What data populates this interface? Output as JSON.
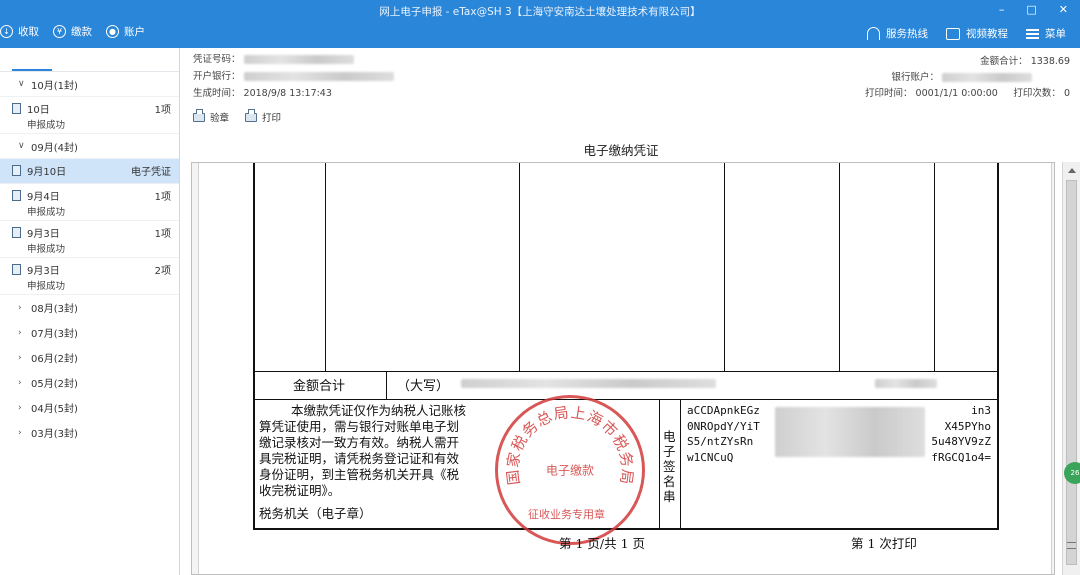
{
  "window": {
    "title": "网上电子申报 - eTax@SH 3【上海守安南达土壤处理技术有限公司】",
    "controls": [
      "–",
      "□",
      "✕"
    ]
  },
  "nav": {
    "left": [
      {
        "label": "收取",
        "icon": "download-icon"
      },
      {
        "label": "缴款",
        "icon": "yen-icon"
      },
      {
        "label": "账户",
        "icon": "user-icon"
      }
    ],
    "right": [
      {
        "label": "服务热线",
        "icon": "headset-icon"
      },
      {
        "label": "视频教程",
        "icon": "video-icon"
      },
      {
        "label": "菜单",
        "icon": "menu-icon"
      }
    ]
  },
  "sidebar": {
    "months": [
      {
        "label": "10月(1封)",
        "expanded": true,
        "records": [
          {
            "date": "10日",
            "count": "1项",
            "status": "申报成功",
            "active": false
          }
        ]
      },
      {
        "label": "09月(4封)",
        "expanded": true,
        "records": [
          {
            "date": "9月10日",
            "count": "电子凭证",
            "status": "",
            "active": true
          },
          {
            "date": "9月4日",
            "count": "1项",
            "status": "申报成功",
            "active": false
          },
          {
            "date": "9月3日",
            "count": "1项",
            "status": "申报成功",
            "active": false
          },
          {
            "date": "9月3日",
            "count": "2项",
            "status": "申报成功",
            "active": false
          }
        ]
      },
      {
        "label": "08月(3封)",
        "expanded": false
      },
      {
        "label": "07月(3封)",
        "expanded": false
      },
      {
        "label": "06月(2封)",
        "expanded": false
      },
      {
        "label": "05月(2封)",
        "expanded": false
      },
      {
        "label": "04月(5封)",
        "expanded": false
      },
      {
        "label": "03月(3封)",
        "expanded": false
      }
    ]
  },
  "header": {
    "voucher_no_label": "凭证号码：",
    "bank_label": "开户银行：",
    "generated_label": "生成时间：",
    "generated_value": "2018/9/8 13:17:43",
    "total_label": "金额合计：",
    "total_value": "1338.69",
    "account_label": "银行账户：",
    "print_time_label": "打印时间：",
    "print_time_value": "0001/1/1 0:00:00",
    "print_count_label": "打印次数：",
    "print_count_value": "0"
  },
  "toolbar": {
    "verify_label": "验章",
    "print_label": "打印"
  },
  "document": {
    "title": "电子缴纳凭证",
    "total_row_label": "金额合计",
    "total_row_prefix": "（大写）",
    "notice_lines": [
      "本缴款凭证仅作为纳税人记账核",
      "算凭证使用，需与银行对账单电子划",
      "缴记录核对一致方有效。纳税人需开",
      "具完税证明，请凭税务登记证和有效",
      "身份证明，到主管税务机关开具《税",
      "收完税证明》。"
    ],
    "tax_authority_label": "税务机关（电子章）",
    "sig_label": "电子签名串",
    "sig_lines": [
      "aCCDApnkEGz",
      "0NROpdY/YiT",
      "S5/ntZYsRn",
      "w1CNCuQ"
    ],
    "sig_right": [
      "in3",
      "X45PYho",
      "5u48YV9zZ",
      "fRGCQ1o4="
    ],
    "stamp_ring_text": "国家税务总局上海市税务局",
    "stamp_center": "电子缴款",
    "stamp_bottom": "征收业务专用章",
    "page_info": "第 1 页/共 1 页",
    "print_info": "第 1 次打印"
  },
  "badge": "26"
}
